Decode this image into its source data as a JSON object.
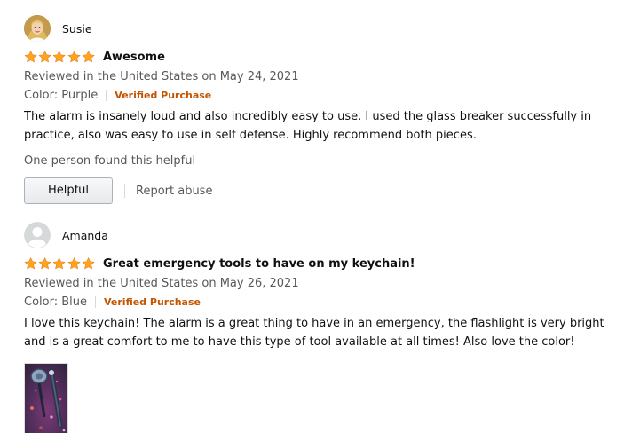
{
  "reviews": [
    {
      "author": "Susie",
      "avatar_icon": "user-photo-avatar",
      "rating": 5,
      "rating_max": 5,
      "title": "Awesome",
      "date": "Reviewed in the United States on May 24, 2021",
      "variant": "Color: Purple",
      "verified": "Verified Purchase",
      "body": "The alarm is insanely loud and also incredibly easy to use. I used the glass breaker successfully in practice, also was easy to use in self defense. Highly recommend both pieces.",
      "helpful_count": "One person found this helpful",
      "helpful_button": "Helpful",
      "report_label": "Report abuse"
    },
    {
      "author": "Amanda",
      "avatar_icon": "default-user-avatar",
      "rating": 5,
      "rating_max": 5,
      "title": "Great emergency tools to have on my keychain!",
      "date": "Reviewed in the United States on May 26, 2021",
      "variant": "Color: Blue",
      "verified": "Verified Purchase",
      "body": "I love this keychain! The alarm is a great thing to have in an emergency, the flashlight is very bright and is a great comfort to me to have this type of tool available at all times! Also love the color!"
    }
  ],
  "colors": {
    "star": "#ffa41c",
    "verified": "#c45500",
    "secondary_text": "#565959",
    "text": "#0f1111"
  }
}
